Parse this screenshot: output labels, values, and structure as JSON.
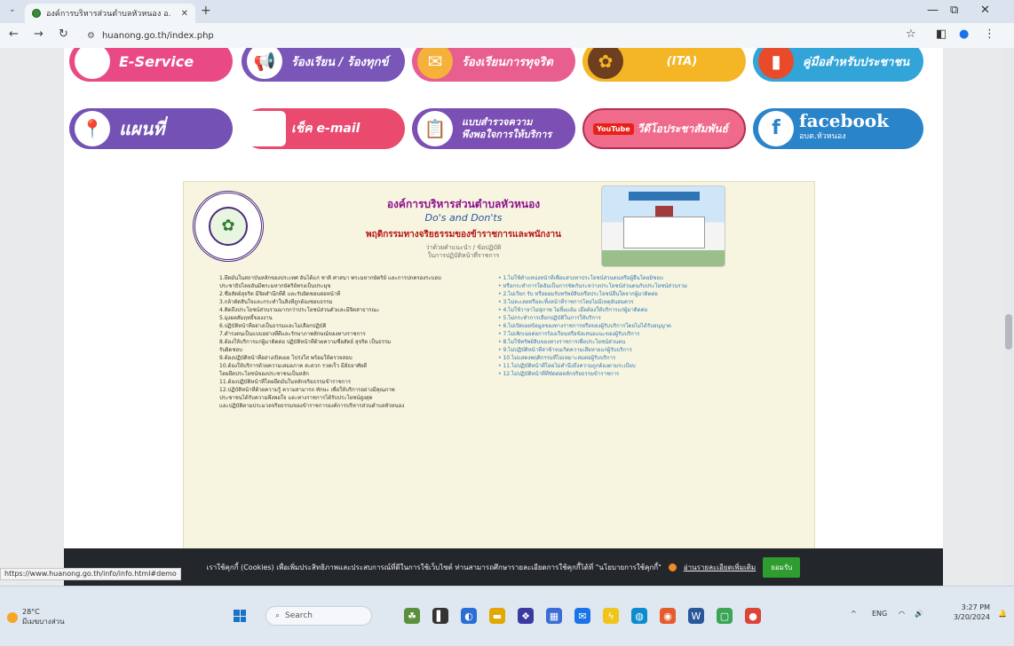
{
  "browser": {
    "tab_title": "องค์การบริหารส่วนตำบลหัวหนอง อ.",
    "url": "huanong.go.th/index.php",
    "status_url": "https://www.huanong.go.th/info/info.html#demo"
  },
  "banner": {
    "eservice": "E-Service",
    "complaint": "ร้องเรียน / ร้องทุกข์",
    "corruption": "ร้องเรียนการทุจริต",
    "ita": "(ITA)",
    "manual": "คู่มือสำหรับประชาชน",
    "map": "แผนที่",
    "email": "เช็ค e-mail",
    "survey_line1": "แบบสำรวจความ",
    "survey_line2": "พึงพอใจการให้บริการ",
    "youtube_brand": "YouTube",
    "youtube": "วีดีโอประชาสัมพันธ์",
    "facebook": "facebook",
    "facebook_sub": "อบต.หัวหนอง"
  },
  "poster": {
    "title": "องค์การบริหารส่วนตำบลหัวหนอง",
    "subtitle": "Do's and Don'ts",
    "subtitle2": "พฤติกรรมทางจริยธรรมของข้าราชการและพนักงาน",
    "note1": "ว่าด้วยคำแนะนำ / ข้อปฏิบัติ",
    "note2": "ในการปฏิบัติหน้าที่ราชการ",
    "left_rules": [
      "1.ยึดมั่นในสถาบันหลักของประเทศ อันได้แก่ ชาติ ศาสนา พระมหากษัตริย์ และการปกครองระบอบ",
      "ประชาธิปไตยอันมีพระมหากษัตริย์ทรงเป็นประมุข",
      "2.ซื่อสัตย์สุจริต มีจิตสำนึกที่ดี และรับผิดชอบต่อหน้าที่",
      "3.กล้าตัดสินใจและกระทำในสิ่งที่ถูกต้องชอบธรรม",
      "4.คิดถึงประโยชน์ส่วนรวมมากกว่าประโยชน์ส่วนตัวและมีจิตสาธารณะ",
      "5.มุ่งผลสัมฤทธิ์ของงาน",
      "6.ปฏิบัติหน้าที่อย่างเป็นธรรมและไม่เลือกปฏิบัติ",
      "7.ดำรงตนเป็นแบบอย่างที่ดีและรักษาภาพลักษณ์ของทางราชการ",
      "8.ต้องให้บริการแก่ผู้มาติดต่อ ปฏิบัติหน้าที่ด้วยความซื่อสัตย์ สุจริต เป็นธรรม",
      "รับผิดชอบ",
      "9.ต้องปฏิบัติหน้าที่อย่างเปิดเผย โปร่งใส พร้อมให้ตรวจสอบ",
      "10.ต้องให้บริการด้วยความเสมอภาค สะดวก รวดเร็ว มีอัธยาศัยดี",
      "โดยยึดประโยชน์ของประชาชนเป็นหลัก",
      "11.ต้องปฏิบัติหน้าที่โดยยึดมั่นในหลักจริยธรรมข้าราชการ",
      "12.ปฏิบัติหน้าที่ด้วยความรู้ ความสามารถ ทักษะ เพื่อให้บริการอย่างมีคุณภาพ",
      "ประชาชนได้รับความพึงพอใจ และทางราชการได้รับประโยชน์สูงสุด",
      "และปฏิบัติตามประมวลจริยธรรมของข้าราชการองค์การบริหารส่วนตำบลหัวหนอง"
    ],
    "right_rules": [
      "1.ไม่ใช้ตำแหน่งหน้าที่เพื่อแสวงหาประโยชน์ส่วนตนหรือผู้อื่นโดยมิชอบ",
      "หรือกระทำการใดอันเป็นการขัดกันระหว่างประโยชน์ส่วนตนกับประโยชน์ส่วนรวม",
      "2.ไม่เรียก รับ หรือยอมรับทรัพย์สินหรือประโยชน์อื่นใดจากผู้มาติดต่อ",
      "3.ไม่ละเลยหรือละทิ้งหน้าที่ราชการโดยไม่มีเหตุอันสมควร",
      "4.ไม่ใช้วาจาไม่สุภาพ ไม่ยิ้มแย้ม เมื่อต้องให้บริการแก่ผู้มาติดต่อ",
      "5.ไม่กระทำการเลือกปฏิบัติในการให้บริการ",
      "6.ไม่เปิดเผยข้อมูลของทางราชการหรือของผู้รับบริการโดยไม่ได้รับอนุญาต",
      "7.ไม่เพิกเฉยต่อการร้องเรียนหรือข้อเสนอแนะของผู้รับบริการ",
      "8.ไม่ใช้ทรัพย์สินของทางราชการเพื่อประโยชน์ส่วนตน",
      "9.ไม่ปฏิบัติหน้าที่ล่าช้าจนเกิดความเสียหายแก่ผู้รับบริการ",
      "10.ไม่แสดงพฤติกรรมที่ไม่เหมาะสมต่อผู้รับบริการ",
      "11.ไม่ปฏิบัติหน้าที่โดยไม่คำนึงถึงความถูกต้องตามระเบียบ",
      "12.ไม่ปฏิบัติหน้าที่ที่ขัดต่อหลักจริยธรรมข้าราชการ"
    ]
  },
  "cookie": {
    "text": "เราใช้คุกกี้ (Cookies) เพื่อเพิ่มประสิทธิภาพและประสบการณ์ที่ดีในการใช้เว็บไซต์ ท่านสามารถศึกษารายละเอียดการใช้คุกกี้ได้ที่ \"นโยบายการใช้คุกกี้\"",
    "link": "อ่านรายละเอียดเพิ่มเติม",
    "accept": "ยอมรับ"
  },
  "taskbar": {
    "temp": "28°C",
    "weather": "มีเมฆบางส่วน",
    "search": "Search",
    "lang": "ENG",
    "time": "3:27 PM",
    "date": "3/20/2024"
  }
}
